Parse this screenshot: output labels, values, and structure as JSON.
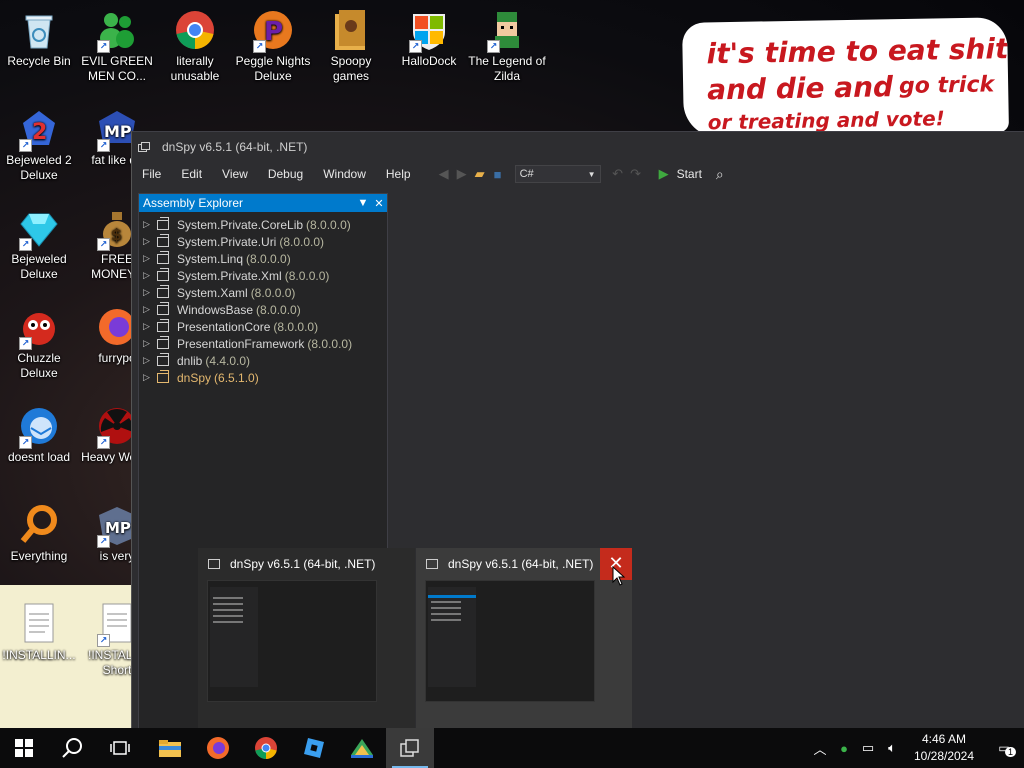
{
  "desktop": {
    "icons": [
      {
        "label": "Recycle Bin"
      },
      {
        "label": "EVIL GREEN MEN CO..."
      },
      {
        "label": "literally unusable"
      },
      {
        "label": "Peggle Nights Deluxe"
      },
      {
        "label": "Spoopy games"
      },
      {
        "label": "HalloDock"
      },
      {
        "label": "The Legend of Zilda"
      },
      {
        "label": "Bejeweled 2 Deluxe"
      },
      {
        "label": "fat like da"
      },
      {
        "label": "Bejeweled Deluxe"
      },
      {
        "label": "FREE MONEY.c"
      },
      {
        "label": "Chuzzle Deluxe"
      },
      {
        "label": "furrypo"
      },
      {
        "label": "doesnt load"
      },
      {
        "label": "Heavy Weap."
      },
      {
        "label": "Everything"
      },
      {
        "label": "is very"
      },
      {
        "label": "!INSTALLIN..."
      },
      {
        "label": "!INSTALL - Short"
      }
    ]
  },
  "meme": {
    "line1": "it's time to eat shit",
    "line2a": "and die and",
    "line2b": "go trick",
    "line3": "or treating and vote!"
  },
  "window": {
    "title": "dnSpy v6.5.1 (64-bit, .NET)",
    "menu": [
      "File",
      "Edit",
      "View",
      "Debug",
      "Window",
      "Help"
    ],
    "language": "C#",
    "start_label": "Start",
    "assembly_explorer": {
      "title": "Assembly Explorer",
      "items": [
        {
          "name": "System.Private.CoreLib",
          "version": "(8.0.0.0)"
        },
        {
          "name": "System.Private.Uri",
          "version": "(8.0.0.0)"
        },
        {
          "name": "System.Linq",
          "version": "(8.0.0.0)"
        },
        {
          "name": "System.Private.Xml",
          "version": "(8.0.0.0)"
        },
        {
          "name": "System.Xaml",
          "version": "(8.0.0.0)"
        },
        {
          "name": "WindowsBase",
          "version": "(8.0.0.0)"
        },
        {
          "name": "PresentationCore",
          "version": "(8.0.0.0)"
        },
        {
          "name": "PresentationFramework",
          "version": "(8.0.0.0)"
        },
        {
          "name": "dnlib",
          "version": "(4.4.0.0)"
        },
        {
          "name": "dnSpy",
          "version": "(6.5.1.0)"
        }
      ]
    }
  },
  "previews": [
    {
      "title": "dnSpy v6.5.1 (64-bit, .NET)"
    },
    {
      "title": "dnSpy v6.5.1 (64-bit, .NET)"
    }
  ],
  "taskbar": {
    "time": "4:46 AM",
    "date": "10/28/2024",
    "notification_count": "1",
    "colors": {
      "accent": "#76b9ed",
      "close_red": "#c42b1c",
      "explorer_blue": "#007acc"
    }
  }
}
